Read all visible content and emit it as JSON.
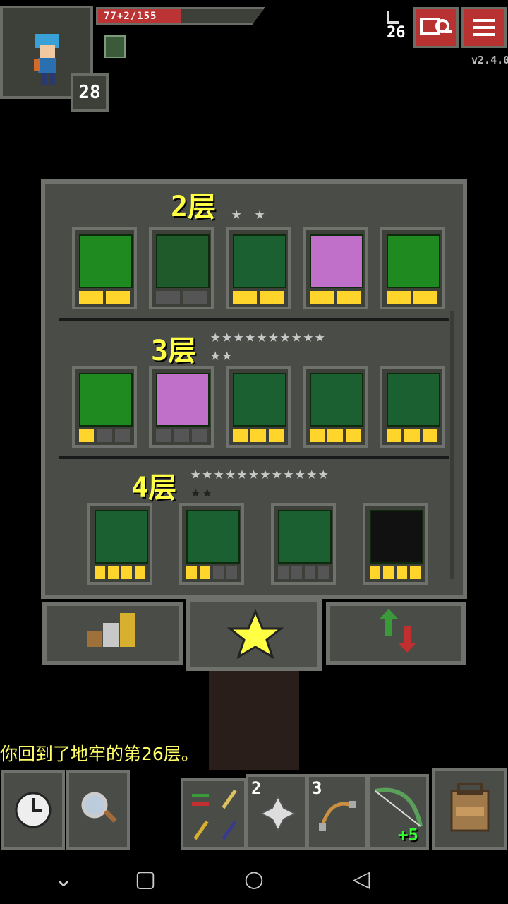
{
  "hud": {
    "hp": {
      "text": "77+2/155",
      "fraction": 0.5
    },
    "hero_level": "28",
    "depth": "26",
    "version": "v2.4.0"
  },
  "badges": {
    "floors": [
      {
        "title": "2层",
        "stars": "★ ★",
        "items": [
          {
            "icon": "clock-magic-badge-icon",
            "pips": [
              1,
              1
            ]
          },
          {
            "icon": "potion-badge-icon",
            "pips": [
              0,
              0
            ]
          },
          {
            "icon": "tree-badge-icon",
            "pips": [
              1,
              1
            ]
          },
          {
            "icon": "pink-skull-badge-icon",
            "pips": [
              1,
              1
            ]
          },
          {
            "icon": "green-weapon-badge-icon",
            "pips": [
              1,
              1
            ]
          }
        ]
      },
      {
        "title": "3层",
        "stars": "★★★★★★★★★★",
        "stars2": "★★",
        "items": [
          {
            "icon": "green-arrow-cross-badge-icon",
            "pips": [
              1,
              0,
              0
            ]
          },
          {
            "icon": "pink-bow-badge-icon",
            "pips": [
              0,
              0,
              0
            ]
          },
          {
            "icon": "tree-leaf-badge-icon",
            "pips": [
              1,
              1,
              1
            ]
          },
          {
            "icon": "tree-shield-badge-icon",
            "pips": [
              1,
              1,
              1
            ]
          },
          {
            "icon": "tree-ring-badge-icon",
            "pips": [
              1,
              1,
              1
            ]
          }
        ]
      },
      {
        "title": "4层",
        "stars": "★★★★★★★★★★★★",
        "stars2": "★★",
        "items": [
          {
            "icon": "bow-red-badge-icon",
            "pips": [
              1,
              1,
              1,
              1
            ]
          },
          {
            "icon": "bow-purple-arrow-badge-icon",
            "pips": [
              1,
              1,
              0,
              0
            ]
          },
          {
            "icon": "bow-skull-badge-icon",
            "pips": [
              0,
              0,
              0,
              0
            ]
          },
          {
            "icon": "ghost-outline-badge-icon",
            "pips": [
              1,
              1,
              1,
              1
            ]
          }
        ]
      }
    ]
  },
  "tabs": [
    "stats-tab",
    "badges-tab",
    "rankings-tab"
  ],
  "message": "你回到了地牢的第26层。",
  "toolbar": {
    "quick_slots": [
      {
        "icon": "shuriken-icon",
        "count": "2"
      },
      {
        "icon": "bolas-icon",
        "count": "3"
      },
      {
        "icon": "bow-icon",
        "count": "+5"
      }
    ]
  }
}
